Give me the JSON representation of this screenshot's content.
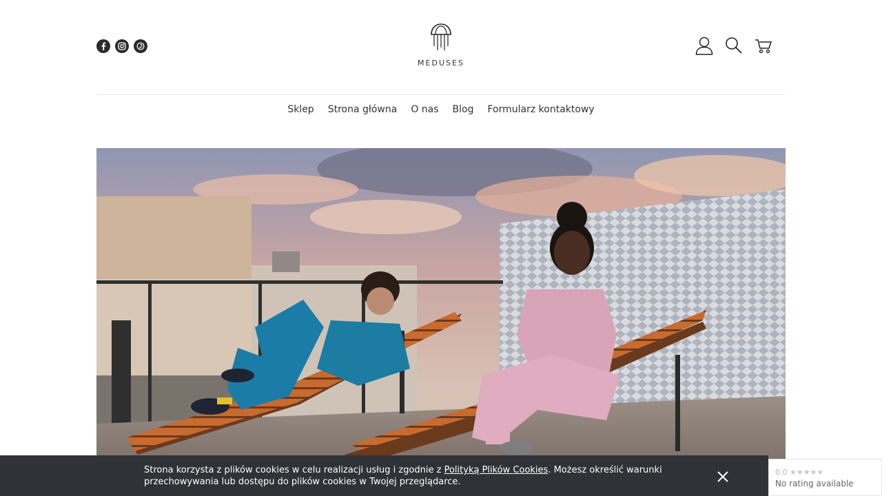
{
  "header": {
    "social": [
      {
        "icon": "facebook-icon"
      },
      {
        "icon": "instagram-icon"
      },
      {
        "icon": "pinterest-icon"
      }
    ],
    "logo_text": "MEDUSES",
    "tools": [
      {
        "icon": "user-icon"
      },
      {
        "icon": "search-icon"
      },
      {
        "icon": "cart-icon"
      }
    ]
  },
  "nav": {
    "items": [
      "Sklep",
      "Strona główna",
      "O nas",
      "Blog",
      "Formularz kontaktowy"
    ]
  },
  "cookie": {
    "text_before": "Strona korzysta z plików cookies w celu realizacji usług i zgodnie z ",
    "link": "Polityką Plików Cookies",
    "text_after": ". Możesz określić warunki przechowywania lub dostępu do plików cookies w Twojej przeglądarce."
  },
  "rating": {
    "score": "0.0",
    "stars": "★★★★★",
    "label": "No rating available"
  },
  "colors": {
    "cookie_bg": "#2f3236",
    "icon_dark": "#2b2b2b"
  }
}
